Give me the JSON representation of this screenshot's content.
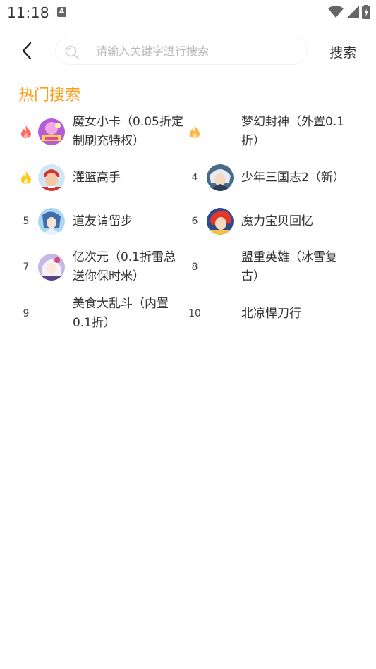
{
  "status": {
    "time": "11:18",
    "notification_letter": "A"
  },
  "search": {
    "placeholder": "请输入关键字进行搜索",
    "value": "",
    "button_label": "搜索"
  },
  "hot": {
    "title": "热门搜索",
    "colors": {
      "title": "#ff9c1a",
      "flame_red": "#ff6b5e",
      "flame_orange": "#ffb547",
      "flame_yellow": "#ffc81c"
    },
    "items": [
      {
        "rank": "",
        "rank_icon": "flame-red-icon",
        "icon": "game-icon-mojo",
        "name": "魔女小卡（0.05折定制刷充特权）"
      },
      {
        "rank": "",
        "rank_icon": "flame-orange-icon",
        "icon": "",
        "name": "梦幻封神（外置0.1折）"
      },
      {
        "rank": "",
        "rank_icon": "flame-yellow-icon",
        "icon": "game-icon-basketball",
        "name": "灌篮高手"
      },
      {
        "rank": "4",
        "rank_icon": "",
        "icon": "game-icon-silverhair",
        "name": "少年三国志2（新）"
      },
      {
        "rank": "5",
        "rank_icon": "",
        "icon": "game-icon-daoyou",
        "name": "道友请留步"
      },
      {
        "rank": "6",
        "rank_icon": "",
        "icon": "game-icon-redhair",
        "name": "魔力宝贝回忆"
      },
      {
        "rank": "7",
        "rank_icon": "",
        "icon": "game-icon-whitehair",
        "name": "亿次元（0.1折雷总送你保时米）"
      },
      {
        "rank": "8",
        "rank_icon": "",
        "icon": "",
        "name": "盟重英雄（冰雪复古）"
      },
      {
        "rank": "9",
        "rank_icon": "",
        "icon": "",
        "name": "美食大乱斗（内置0.1折）"
      },
      {
        "rank": "10",
        "rank_icon": "",
        "icon": "",
        "name": "北凉悍刀行"
      }
    ]
  }
}
